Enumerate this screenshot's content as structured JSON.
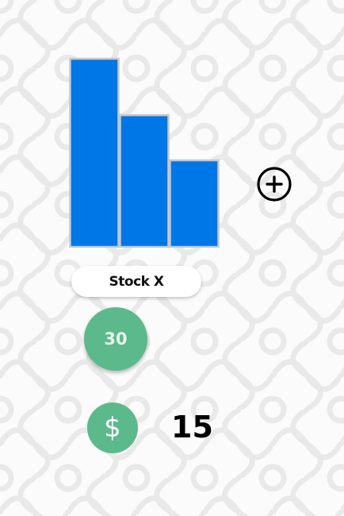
{
  "chart_data": {
    "type": "bar",
    "categories": [
      "",
      "",
      ""
    ],
    "values": [
      100,
      70,
      46
    ],
    "ylim": [
      0,
      100
    ],
    "title": "",
    "xlabel": "",
    "ylabel": "",
    "grid": false,
    "bar_color": "#0077e6",
    "bar_border_color": "#c8c8c8"
  },
  "stock": {
    "name": "Stock X",
    "count": "30"
  },
  "wallet": {
    "currency_symbol": "$",
    "amount": "15"
  },
  "icons": {
    "add": "plus-circle-icon",
    "currency": "dollar-icon"
  },
  "colors": {
    "accent_green": "#5cb98c",
    "bar_blue": "#0077e6",
    "background": "#fbfbfb"
  }
}
